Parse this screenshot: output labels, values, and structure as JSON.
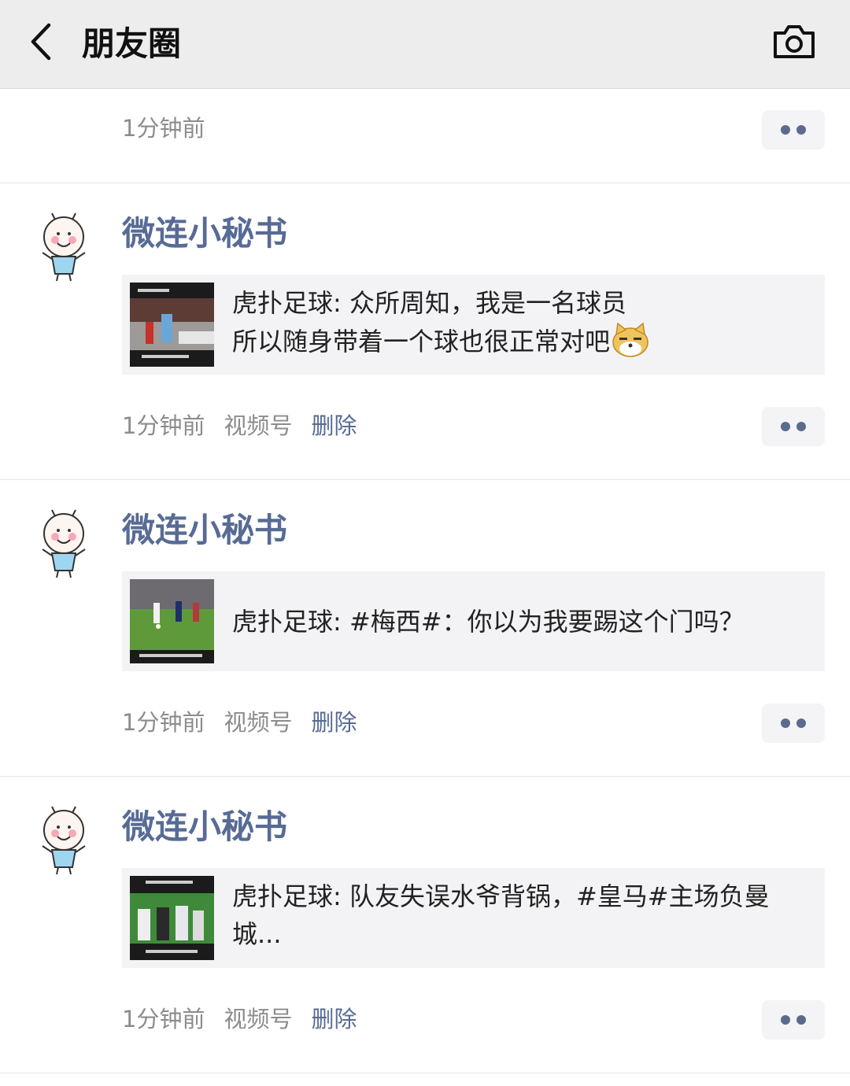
{
  "header": {
    "title": "朋友圈"
  },
  "top_item": {
    "time": "1分钟前"
  },
  "posts": [
    {
      "author": "微连小秘书",
      "text": "虎扑足球: 众所周知，我是一名球员\n所以随身带着一个球也很正常对吧",
      "emoji": "doge-emoji",
      "time": "1分钟前",
      "channel": "视频号",
      "delete": "删除"
    },
    {
      "author": "微连小秘书",
      "text": "虎扑足球: #梅西#：你以为我要踢这个门吗？",
      "time": "1分钟前",
      "channel": "视频号",
      "delete": "删除"
    },
    {
      "author": "微连小秘书",
      "text": "虎扑足球: 队友失误水爷背锅，#皇马#主场负曼城...",
      "time": "1分钟前",
      "channel": "视频号",
      "delete": "删除"
    }
  ],
  "colors": {
    "link": "#576b95",
    "header_bg": "#ededed",
    "card_bg": "#f3f3f5"
  }
}
